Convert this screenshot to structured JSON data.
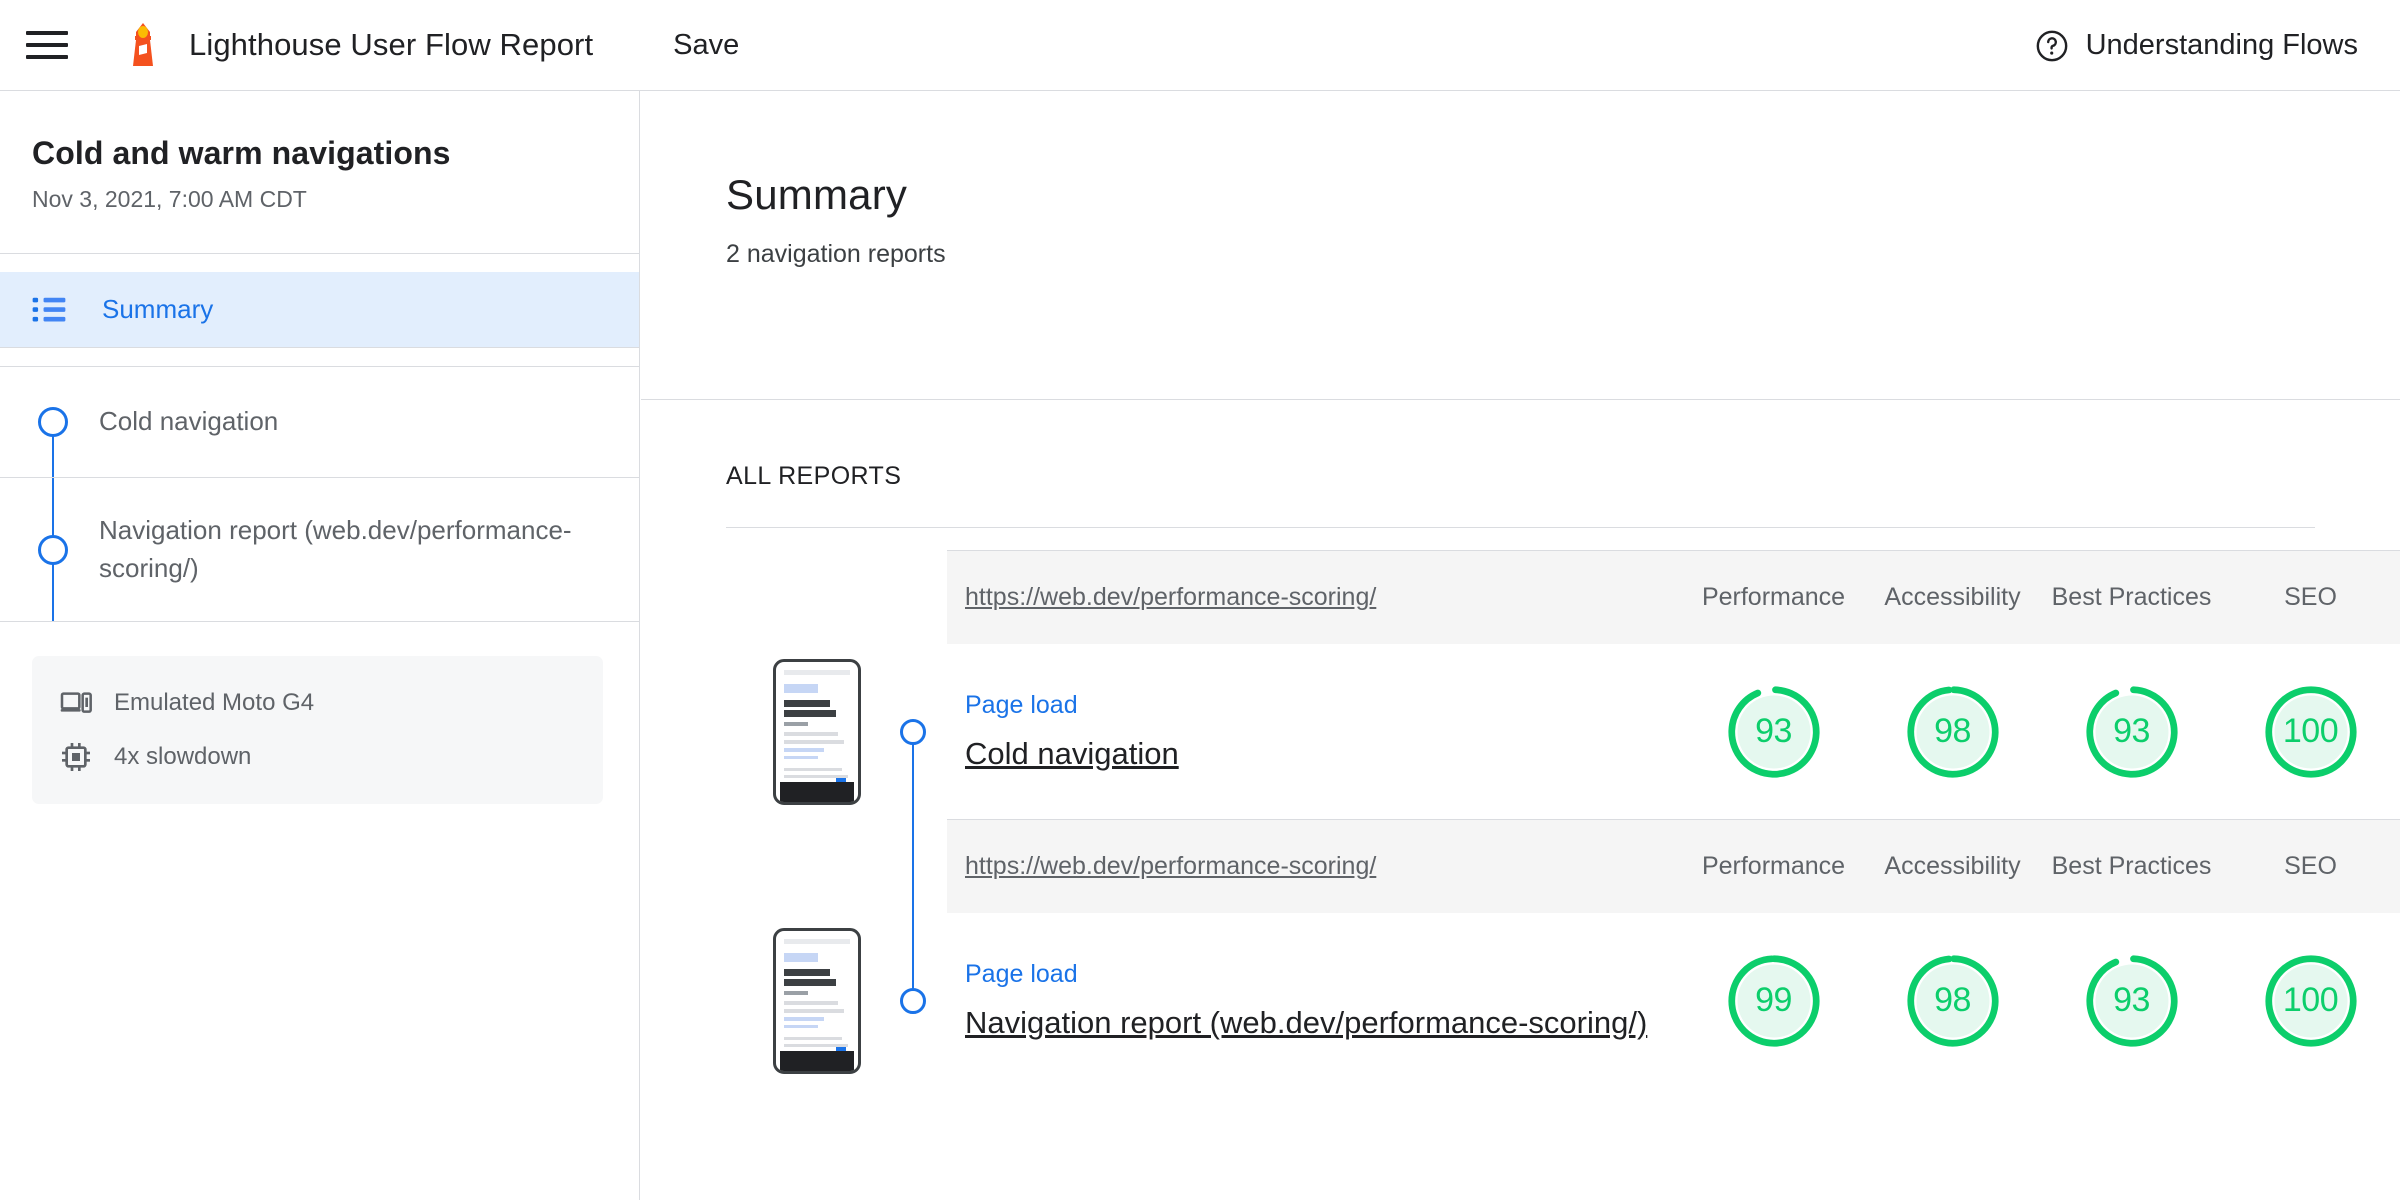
{
  "topbar": {
    "menu_icon": "hamburger-menu-icon",
    "logo_icon": "lighthouse-logo-icon",
    "title": "Lighthouse User Flow Report",
    "save_label": "Save",
    "help_icon": "help-circle-icon",
    "help_label": "Understanding Flows"
  },
  "sidebar": {
    "flow_title": "Cold and warm navigations",
    "flow_date": "Nov 3, 2021, 7:00 AM CDT",
    "nav": {
      "summary_icon": "list-bullet-icon",
      "summary_label": "Summary"
    },
    "steps": [
      {
        "label": "Cold navigation"
      },
      {
        "label": "Navigation report (web.dev/performance-scoring/)"
      }
    ],
    "environment": [
      {
        "icon": "device-mobile-icon",
        "text": "Emulated Moto G4"
      },
      {
        "icon": "cpu-chip-icon",
        "text": "4x slowdown"
      }
    ]
  },
  "main": {
    "title": "Summary",
    "subtitle": "2 navigation reports",
    "section_label": "ALL REPORTS",
    "columns": [
      "Performance",
      "Accessibility",
      "Best Practices",
      "SEO"
    ],
    "reports": [
      {
        "url": "https://web.dev/performance-scoring/",
        "kind": "Page load",
        "name": "Cold navigation",
        "scores": [
          {
            "category": "Performance",
            "value": 93
          },
          {
            "category": "Accessibility",
            "value": 98
          },
          {
            "category": "Best Practices",
            "value": 93
          },
          {
            "category": "SEO",
            "value": 100
          }
        ]
      },
      {
        "url": "https://web.dev/performance-scoring/",
        "kind": "Page load",
        "name": "Navigation report (web.dev/performance-scoring/)",
        "scores": [
          {
            "category": "Performance",
            "value": 99
          },
          {
            "category": "Accessibility",
            "value": 98
          },
          {
            "category": "Best Practices",
            "value": 93
          },
          {
            "category": "SEO",
            "value": 100
          }
        ]
      }
    ]
  },
  "colors": {
    "accent_blue": "#1a73e8",
    "score_green": "#0cce6b",
    "score_green_bg": "#e5f8ef",
    "selected_bg": "#e2eefd",
    "border": "#dadce0",
    "logo_orange": "#f4511e"
  }
}
